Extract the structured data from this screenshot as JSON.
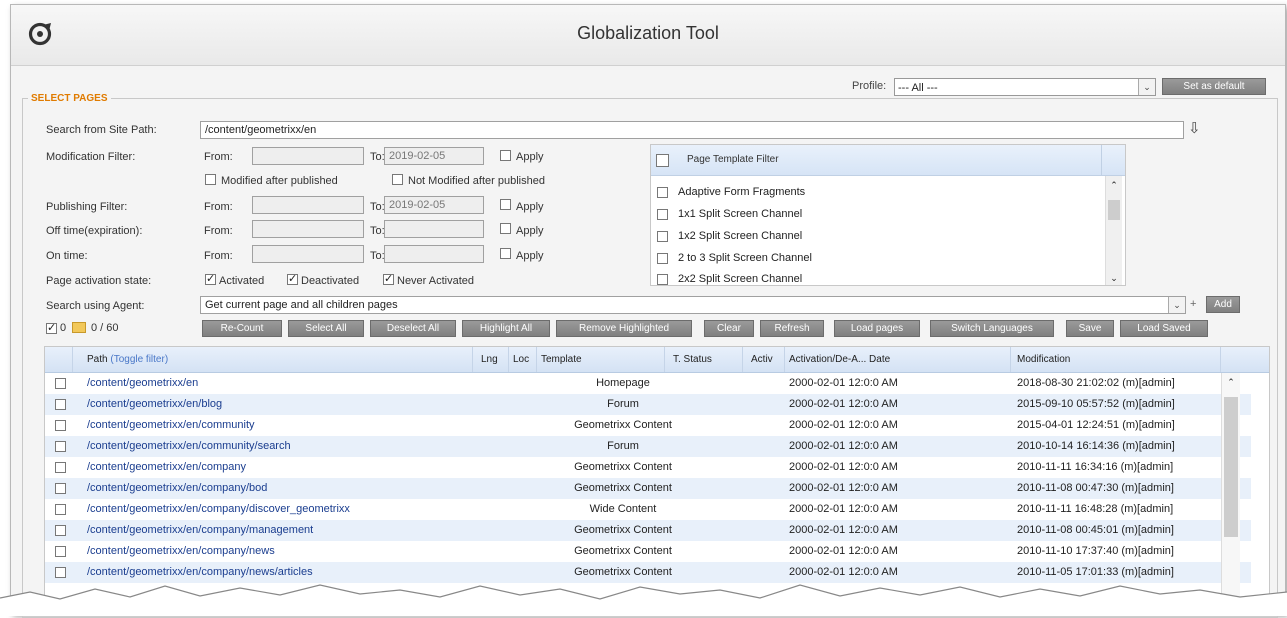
{
  "window": {
    "title": "Globalization Tool"
  },
  "profile": {
    "label": "Profile:",
    "value": "--- All ---",
    "set_default_label": "Set as default"
  },
  "select_pages": {
    "legend": "SELECT PAGES"
  },
  "search_path": {
    "label": "Search from Site Path:",
    "value": "/content/geometrixx/en"
  },
  "filters": {
    "from_label": "From:",
    "to_label": "To:",
    "apply_label": "Apply",
    "modification": {
      "label": "Modification Filter:",
      "to_value": "2019-02-05"
    },
    "modified_after_label": "Modified after published",
    "not_modified_after_label": "Not Modified after published",
    "publishing": {
      "label": "Publishing Filter:",
      "to_value": "2019-02-05"
    },
    "off_time": {
      "label": "Off time(expiration):"
    },
    "on_time": {
      "label": "On time:"
    },
    "activation": {
      "label": "Page activation state:",
      "activated": "Activated",
      "deactivated": "Deactivated",
      "never_activated": "Never Activated"
    }
  },
  "template_filter": {
    "header": "Page Template Filter",
    "items": [
      "Adaptive Form Fragments",
      "1x1 Split Screen Channel",
      "1x2 Split Screen Channel",
      "2 to 3 Split Screen Channel",
      "2x2 Split Screen Channel"
    ]
  },
  "agent": {
    "label": "Search using Agent:",
    "value": "Get current page and all children pages",
    "plus": "+",
    "add_label": "Add"
  },
  "counts": {
    "checked": "0",
    "total": "0 / 60"
  },
  "toolbar": [
    "Re-Count",
    "Select All",
    "Deselect All",
    "Highlight All",
    "Remove Highlighted",
    "Clear",
    "Refresh",
    "Load pages",
    "Switch Languages",
    "Save",
    "Load Saved"
  ],
  "grid": {
    "headers": {
      "path": "Path",
      "toggle": "(Toggle filter)",
      "lng": "Lng",
      "loc": "Loc",
      "template": "Template",
      "tstatus": "T. Status",
      "activ": "Activ",
      "activation_date": "Activation/De-A... Date",
      "modification": "Modification"
    },
    "rows": [
      {
        "path": "/content/geometrixx/en",
        "template": "Homepage",
        "date": "2000-02-01 12:0:0 AM",
        "modification": "2018-08-30 21:02:02 (m)[admin]"
      },
      {
        "path": "/content/geometrixx/en/blog",
        "template": "Forum",
        "date": "2000-02-01 12:0:0 AM",
        "modification": "2015-09-10 05:57:52 (m)[admin]"
      },
      {
        "path": "/content/geometrixx/en/community",
        "template": "Geometrixx Content",
        "date": "2000-02-01 12:0:0 AM",
        "modification": "2015-04-01 12:24:51 (m)[admin]"
      },
      {
        "path": "/content/geometrixx/en/community/search",
        "template": "Forum",
        "date": "2000-02-01 12:0:0 AM",
        "modification": "2010-10-14 16:14:36 (m)[admin]"
      },
      {
        "path": "/content/geometrixx/en/company",
        "template": "Geometrixx Content",
        "date": "2000-02-01 12:0:0 AM",
        "modification": "2010-11-11 16:34:16 (m)[admin]"
      },
      {
        "path": "/content/geometrixx/en/company/bod",
        "template": "Geometrixx Content",
        "date": "2000-02-01 12:0:0 AM",
        "modification": "2010-11-08 00:47:30 (m)[admin]"
      },
      {
        "path": "/content/geometrixx/en/company/discover_geometrixx",
        "template": "Wide Content",
        "date": "2000-02-01 12:0:0 AM",
        "modification": "2010-11-11 16:48:28 (m)[admin]"
      },
      {
        "path": "/content/geometrixx/en/company/management",
        "template": "Geometrixx Content",
        "date": "2000-02-01 12:0:0 AM",
        "modification": "2010-11-08 00:45:01 (m)[admin]"
      },
      {
        "path": "/content/geometrixx/en/company/news",
        "template": "Geometrixx Content",
        "date": "2000-02-01 12:0:0 AM",
        "modification": "2010-11-10 17:37:40 (m)[admin]"
      },
      {
        "path": "/content/geometrixx/en/company/news/articles",
        "template": "Geometrixx Content",
        "date": "2000-02-01 12:0:0 AM",
        "modification": "2010-11-05 17:01:33 (m)[admin]"
      }
    ]
  }
}
